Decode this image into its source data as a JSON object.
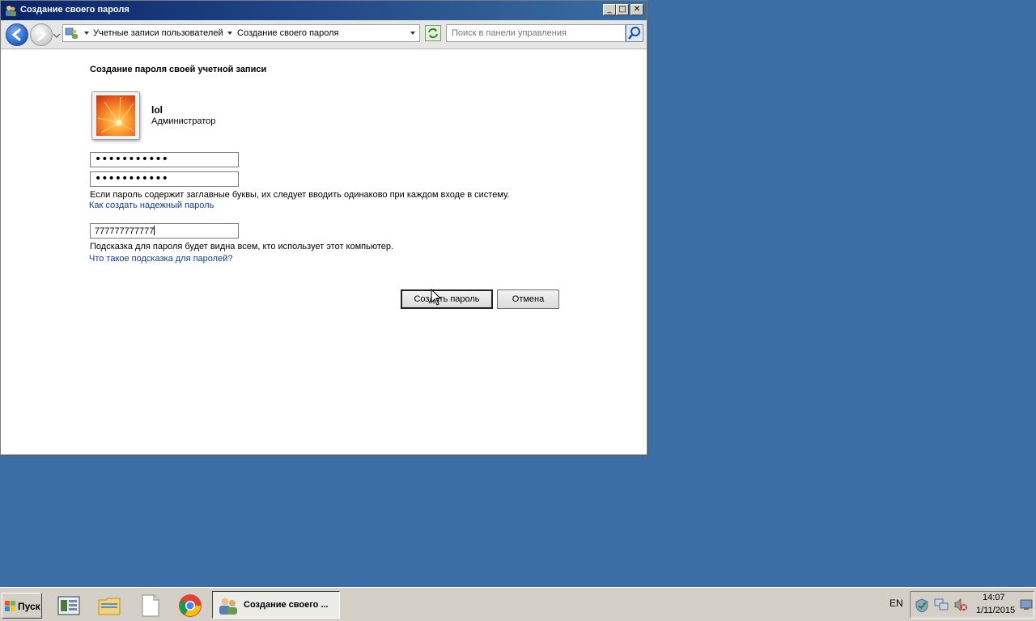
{
  "window": {
    "title": "Создание своего пароля",
    "minimize": "_",
    "maximize": "□",
    "close": "✕"
  },
  "address_bar": {
    "crumbs": [
      "Учетные записи пользователей",
      "Создание своего пароля"
    ],
    "search_placeholder": "Поиск в панели управления"
  },
  "content": {
    "heading": "Создание пароля своей учетной записи",
    "user": {
      "name": "lol",
      "role": "Администратор"
    },
    "password": "•••••••••••",
    "password_confirm": "•••••••••••",
    "caps_note": "Если пароль содержит заглавные буквы, их следует вводить одинаково при каждом входе в систему.",
    "strong_password_link": "Как создать надежный пароль",
    "hint_value": "777777777777",
    "hint_note": "Подсказка для пароля будет видна всем, кто использует этот компьютер.",
    "hint_link": "Что такое подсказка для паролей?",
    "create_button": "Создать пароль",
    "cancel_button": "Отмена"
  },
  "taskbar": {
    "start_label": "Пуск",
    "active_task": "Создание своего ...",
    "language": "EN",
    "time": "14:07",
    "date": "1/11/2015"
  },
  "colors": {
    "desktop": "#3a6ea5",
    "link": "#0f3a8e",
    "titlebar": "#0a246a"
  }
}
